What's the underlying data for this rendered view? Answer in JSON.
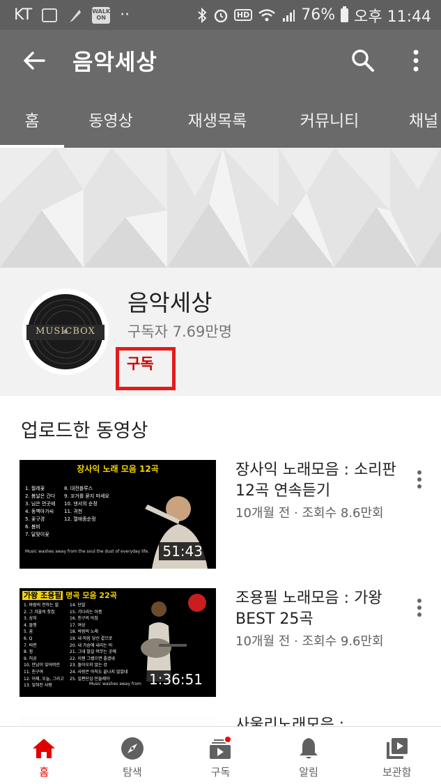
{
  "status_bar": {
    "carrier": "KT",
    "walk_badge": "WALK ON",
    "hd_badge": "HD",
    "battery": "76%",
    "time": "오후 11:44"
  },
  "app_bar": {
    "title": "음악세상",
    "icons": [
      "back-arrow-icon",
      "search-icon",
      "more-vert-icon"
    ]
  },
  "tabs": [
    {
      "label": "홈",
      "active": true
    },
    {
      "label": "동영상",
      "active": false
    },
    {
      "label": "재생목록",
      "active": false
    },
    {
      "label": "커뮤니티",
      "active": false
    },
    {
      "label": "채널",
      "active": false
    }
  ],
  "channel": {
    "name": "음악세상",
    "subscribers": "구독자 7.69만명",
    "subscribe_label": "구독",
    "avatar_text": "MUSICBOX"
  },
  "section": {
    "title": "업로드한 동영상"
  },
  "videos": [
    {
      "title": "장사익 노래모음 : 소리판 12곡 연속듣기",
      "meta": "10개월 전 · 조회수 8.6만회",
      "duration": "51:43",
      "thumb_heading": "장사익 노래 모음 12곡",
      "thumb_list_left": [
        "1. 찔레꽃",
        "2. 봄날은 간다",
        "3. 님은 먼곳에",
        "4. 동백아가씨",
        "5. 꽃구경",
        "6. 봄비",
        "7. 달맞이꽃"
      ],
      "thumb_list_right": [
        "8. 대전블루스",
        "9. 꼬거를 묻지 마세요",
        "10. 댄서의 순정",
        "11. 귀천",
        "12. 열애종순정"
      ],
      "thumb_quote": "Music washes away from the soul the dust of everyday life."
    },
    {
      "title": "조용필 노래모음 : 가왕 BEST 25곡",
      "meta": "10개월 전 · 조회수 9.6만회",
      "duration": "1:36:51",
      "thumb_heading_a": "가왕 조용필",
      "thumb_heading_b": "명곡 모음 22곡",
      "thumb_list_left": [
        "1. 바람의 전하는 말",
        "2. 그 겨울의 찻집",
        "3. 상처",
        "4. 돌멩",
        "5. 꿈",
        "6. Q",
        "7. 비련",
        "8. 정",
        "9. 허공",
        "10. 만남이 잊어버린",
        "11. 친구여",
        "12. 어제, 오늘, 그리고",
        "13. 잊혀진 사랑"
      ],
      "thumb_list_right": [
        "14. 단발",
        "15. 기다리는 아픔",
        "16. 친구의 아침",
        "17. 여상",
        "18. 바람의 노래",
        "19. 내 마음 당신 곁으로",
        "20. 내 가슴에 내리는 비",
        "21. 그대 발길 머무는 곳에",
        "22. 이젠 그랬으면 좋겠네",
        "23. 돌아오지 않는 강",
        "24. 사랑은 아직도 끝나지 않았네",
        "25. 일편단심 민들레야"
      ],
      "thumb_quote": "Music washes away from"
    }
  ],
  "peek_title": "사울리노래모음 :",
  "bottom_nav": [
    {
      "label": "홈",
      "icon": "home-icon",
      "active": true
    },
    {
      "label": "탐색",
      "icon": "explore-compass-icon",
      "active": false
    },
    {
      "label": "구독",
      "icon": "subscriptions-icon",
      "active": false
    },
    {
      "label": "알림",
      "icon": "bell-icon",
      "active": false
    },
    {
      "label": "보관함",
      "icon": "library-icon",
      "active": false
    }
  ],
  "colors": {
    "app_bar": "#6a6a6a",
    "status_bar": "#5f5f5f",
    "accent_red": "#e00000",
    "highlight_box": "#e31b1b"
  }
}
